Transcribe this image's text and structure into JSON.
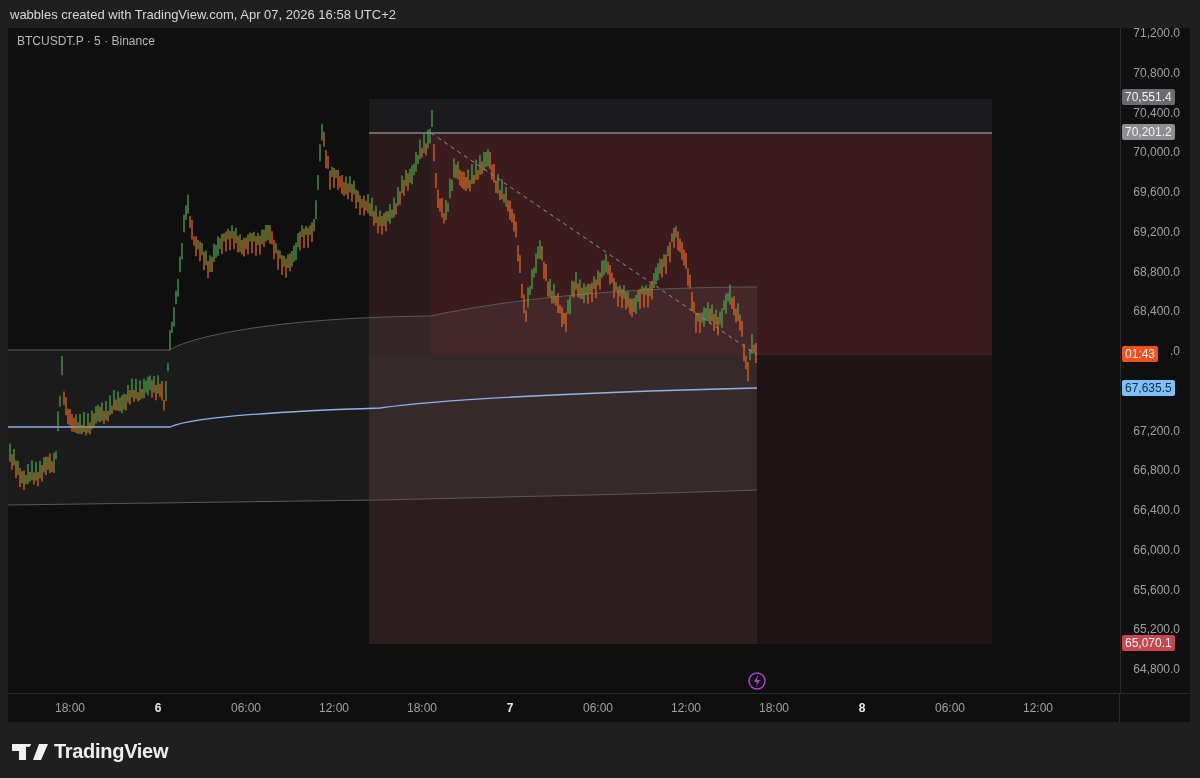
{
  "header": {
    "text": "wabbles created with TradingView.com, Apr 07, 2026 16:58 UTC+2"
  },
  "chart": {
    "symbol": "BTCUSDT.P · 5 · Binance",
    "price_axis": {
      "labels": [
        "71,200.0",
        "70,800.0",
        "70,400.0",
        "70,000.0",
        "69,600.0",
        "69,200.0",
        "68,800.0",
        "68,400.0",
        ".0",
        "67,200.0",
        "66,800.0",
        "66,400.0",
        "66,000.0",
        "65,600.0",
        "65,200.0",
        "64,800.0"
      ]
    },
    "price_tags": [
      {
        "text": "70,551.4",
        "color": "#6b6b70"
      },
      {
        "text": "70,201.2",
        "color": "#8d8d92"
      },
      {
        "text": "01:43",
        "color": "#f4511e"
      },
      {
        "text": "67,635.5",
        "color": "#7ec0f8"
      },
      {
        "text": "65,070.1",
        "color": "#c6474f"
      }
    ],
    "time_axis": {
      "labels": [
        {
          "text": "18:00",
          "bold": false
        },
        {
          "text": "6",
          "bold": true
        },
        {
          "text": "06:00",
          "bold": false
        },
        {
          "text": "12:00",
          "bold": false
        },
        {
          "text": "18:00",
          "bold": false
        },
        {
          "text": "7",
          "bold": true
        },
        {
          "text": "06:00",
          "bold": false
        },
        {
          "text": "12:00",
          "bold": false
        },
        {
          "text": "18:00",
          "bold": false
        },
        {
          "text": "8",
          "bold": true
        },
        {
          "text": "06:00",
          "bold": false
        },
        {
          "text": "12:00",
          "bold": false
        }
      ]
    }
  },
  "footer": {
    "logo_text": "TradingView"
  }
}
